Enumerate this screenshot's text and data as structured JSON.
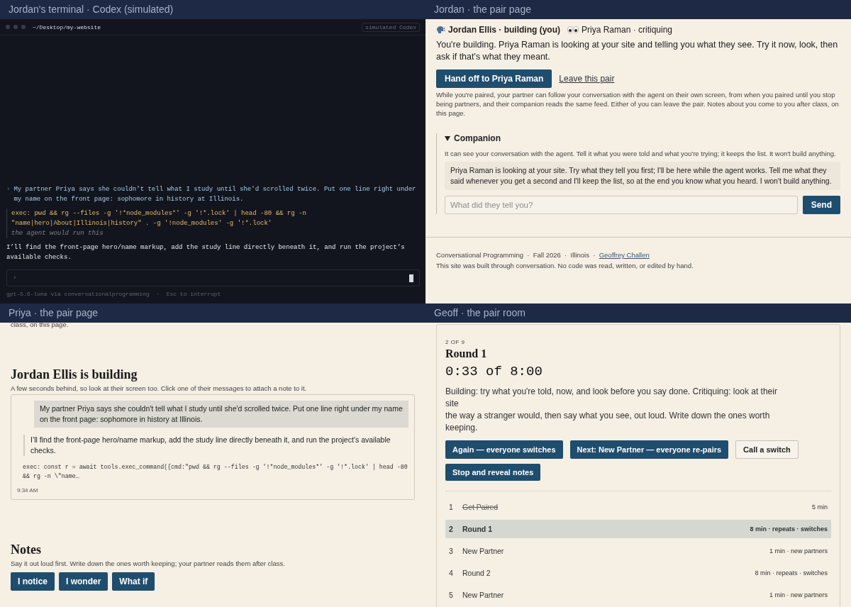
{
  "terminal": {
    "title": "Jordan's terminal · Codex (simulated)",
    "path": "~/Desktop/my-website",
    "badge": "simulated Codex",
    "user_marker": "›",
    "user_message": "My partner Priya says she couldn't tell what I study until she'd scrolled twice. Put one line right under my name on the front page: sophomore in history at Illinois.",
    "exec_command": "exec: pwd && rg --files -g '!*node_modules*' -g '!*.lock' | head -80 && rg -n \"name|hero|About|Illinois|history\" . -g '!node_modules' -g '!*.lock'",
    "exec_note": "the agent would run this",
    "agent_reply": "I’ll find the front-page hero/name markup, add the study line directly beneath it, and run the project’s available checks.",
    "input_marker": "›",
    "footer": "gpt-5.6-luna via conversationalprogramming  ·  Esc to interrupt"
  },
  "jordan_page": {
    "title": "Jordan · the pair page",
    "roles": [
      {
        "label": "Jordan Ellis · building (you)",
        "kind": "building"
      },
      {
        "label": "Priya Raman · critiquing",
        "kind": "critiquing"
      }
    ],
    "intro": "You're building. Priya Raman is looking at your site and telling you what they see. Try it now, look, then ask if that's what they meant.",
    "handoff_button": "Hand off to Priya Raman",
    "leave_link": "Leave this pair",
    "fine_print": "While you're paired, your partner can follow your conversation with the agent on their own screen, from when you paired until you stop being partners, and their companion reads the same feed. Either of you can leave the pair. Notes about you come to you after class, on this page.",
    "companion": {
      "title": "Companion",
      "expanded": true,
      "intro": "It can see your conversation with the agent. Tell it what you were told and what you're trying; it keeps the list. It won't build anything.",
      "message": "Priya Raman is looking at your site. Try what they tell you first; I'll be here while the agent works. Tell me what they said whenever you get a second and I'll keep the list, so at the end you know what you heard. I won't build anything.",
      "placeholder": "What did they tell you?",
      "send_button": "Send"
    },
    "footer": {
      "credit": "Conversational Programming  ·  Fall 2026  ·  Illinois  ·  ",
      "link": "Geoffrey Challen",
      "note": "This site was built through conversation. No code was read, written, or edited by hand."
    }
  },
  "priya_page": {
    "title": "Priya · the pair page",
    "cut_text": "class, on this page.",
    "heading": "Jordan Ellis is building",
    "subtitle": "A few seconds behind, so look at their screen too. Click one of their messages to attach a note to it.",
    "feed": {
      "user_message": "My partner Priya says she couldn't tell what I study until she'd scrolled twice. Put one line right under my name on the front page: sophomore in history at Illinois.",
      "agent_reply": "I’ll find the front-page hero/name markup, add the study line directly beneath it, and run the project’s available checks.",
      "exec_line": "exec: const r = await tools.exec_command({cmd:\"pwd && rg --files -g '!*node_modules*' -g '!*.lock' | head -80 && rg -n \\\"name…",
      "time": "9:34 AM"
    },
    "notes": {
      "heading": "Notes",
      "hint": "Say it out loud first. Write down the ones worth keeping; your partner reads them after class.",
      "buttons": [
        "I notice",
        "I wonder",
        "What if"
      ]
    }
  },
  "geoff_room": {
    "title": "Geoff · the pair room",
    "counter": "2 OF 9",
    "round_title": "Round 1",
    "timer": "0:33 of 8:00",
    "instructions": [
      "Building: try what you're told, now, and look before you say done. Critiquing: look at their site",
      "the way a stranger would, then say what you see, out loud. Write down the ones worth keeping."
    ],
    "buttons": [
      {
        "label": "Again — everyone switches",
        "kind": "primary"
      },
      {
        "label": "Next: New Partner — everyone re-pairs",
        "kind": "primary"
      },
      {
        "label": "Call a switch",
        "kind": "secondary"
      },
      {
        "label": "Stop and reveal notes",
        "kind": "primary"
      }
    ],
    "steps": [
      {
        "number": "1",
        "name": "Get Paired",
        "detail": "5 min",
        "done": true,
        "selected": false
      },
      {
        "number": "2",
        "name": "Round 1",
        "detail": "8 min · repeats · switches",
        "done": false,
        "selected": true
      },
      {
        "number": "3",
        "name": "New Partner",
        "detail": "1 min · new partners",
        "done": false,
        "selected": false
      },
      {
        "number": "4",
        "name": "Round 2",
        "detail": "8 min · repeats · switches",
        "done": false,
        "selected": false
      },
      {
        "number": "5",
        "name": "New Partner",
        "detail": "1 min · new partners",
        "done": false,
        "selected": false
      }
    ]
  }
}
